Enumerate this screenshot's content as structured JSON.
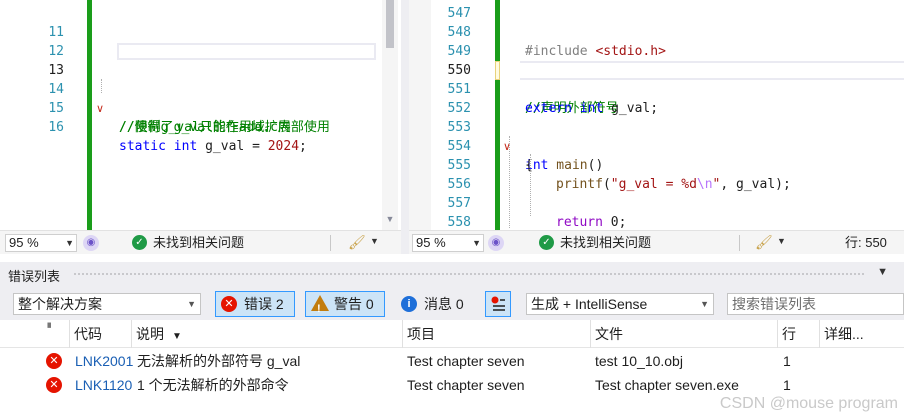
{
  "left_editor": {
    "lines": [
      {
        "num": "11",
        "code": ""
      },
      {
        "num": "12",
        "code": ""
      },
      {
        "num": "13",
        "code": ""
      },
      {
        "num": "14",
        "code": "//限制了g_val的作用域扩展"
      },
      {
        "num": "15",
        "code": "//使得g_val只能在add.c内部使用"
      },
      {
        "num": "16",
        "code_kw1": "static",
        "code_kw2": "int",
        "code_mid": " g_val = ",
        "code_num": "2024",
        "code_end": ";"
      }
    ],
    "zoom": "95 %",
    "status_text": "未找到相关问题"
  },
  "right_editor": {
    "line_numbers": [
      "547",
      "548",
      "549",
      "550",
      "551",
      "552",
      "553",
      "554",
      "555",
      "556",
      "557",
      "558"
    ],
    "line_548": {
      "pp": "#include ",
      "str": "<stdio.h>"
    },
    "line_550": "//声明外部符号",
    "line_551": {
      "kw1": "extern",
      "kw2": "int",
      "rest": " g_val;"
    },
    "line_553": {
      "kw": "int",
      "fn": " main",
      "rest": "()"
    },
    "line_554": "{",
    "line_555": {
      "fn": "printf",
      "p1": "(",
      "s1": "\"g_val = %d",
      "esc": "\\n",
      "s2": "\"",
      "rest": ", g_val);"
    },
    "line_557": {
      "kw": "return",
      "rest": " 0;"
    },
    "line_558": "}",
    "zoom": "95 %",
    "status_text": "未找到相关问题",
    "line_indicator": "行: 550"
  },
  "error_list": {
    "title": "错误列表",
    "scope": "整个解决方案",
    "errors_label": "错误 2",
    "warnings_label": "警告 0",
    "messages_label": "消息 0",
    "build_filter": "生成 + IntelliSense",
    "search_placeholder": "搜索错误列表",
    "columns": {
      "code": "代码",
      "description": "说明",
      "project": "项目",
      "file": "文件",
      "line": "行",
      "details": "详细..."
    },
    "rows": [
      {
        "code": "LNK2001",
        "description": "无法解析的外部符号 g_val",
        "project": "Test chapter seven",
        "file": "test 10_10.obj",
        "line": "1"
      },
      {
        "code": "LNK1120",
        "description": "1 个无法解析的外部命令",
        "project": "Test chapter seven",
        "file": "Test chapter seven.exe",
        "line": "1"
      }
    ]
  },
  "watermark": "CSDN @mouse program",
  "colors": {
    "accent": "#3399ff",
    "error": "#e51400",
    "change_bar": "#1a9d1a"
  }
}
